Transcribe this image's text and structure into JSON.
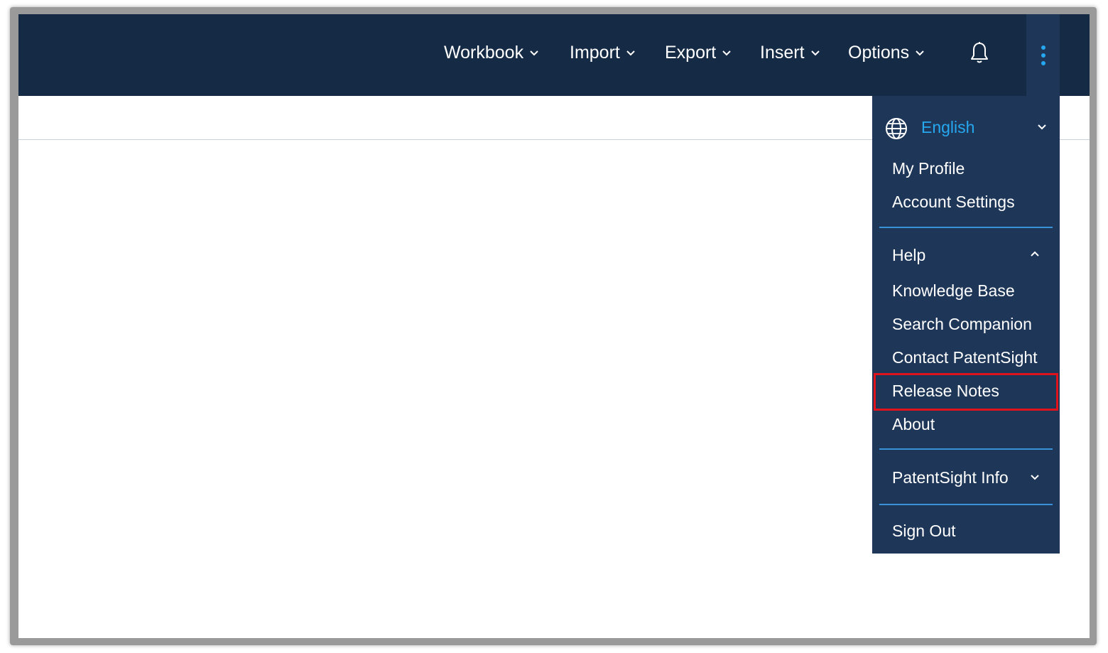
{
  "topbar": {
    "nav": [
      {
        "label": "Workbook",
        "icon": "chevron-down-icon"
      },
      {
        "label": "Import",
        "icon": "chevron-down-icon"
      },
      {
        "label": "Export",
        "icon": "chevron-down-icon"
      },
      {
        "label": "Insert",
        "icon": "chevron-down-icon"
      },
      {
        "label": "Options",
        "icon": "chevron-down-icon"
      }
    ],
    "notification_icon": "bell-icon",
    "more_icon": "vertical-dots-icon"
  },
  "menu": {
    "language": {
      "label": "English",
      "icon": "globe-icon",
      "state": "collapsed"
    },
    "account": [
      {
        "label": "My Profile"
      },
      {
        "label": "Account Settings"
      }
    ],
    "help": {
      "label": "Help",
      "state": "expanded",
      "items": [
        {
          "label": "Knowledge Base"
        },
        {
          "label": "Search Companion"
        },
        {
          "label": "Contact PatentSight"
        },
        {
          "label": "Release Notes",
          "highlighted": true
        },
        {
          "label": "About"
        }
      ]
    },
    "info": {
      "label": "PatentSight Info",
      "state": "collapsed"
    },
    "sign_out": {
      "label": "Sign Out"
    }
  },
  "colors": {
    "topbar": "#152a45",
    "menu_bg": "#1e3658",
    "accent_blue": "#26a8f0",
    "divider": "#3a92d6",
    "highlight_border": "#e0121b"
  }
}
